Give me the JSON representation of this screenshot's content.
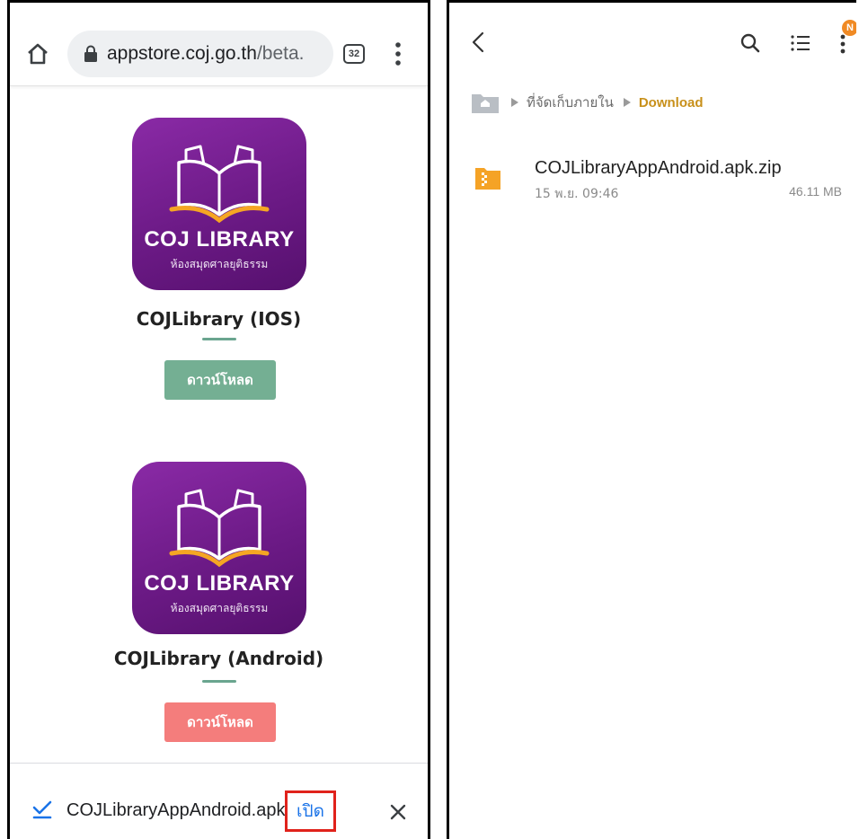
{
  "browser": {
    "url_host": "appstore.coj.go.th",
    "url_path": "/beta.",
    "tab_count": "32"
  },
  "apps": [
    {
      "icon_title": "COJ LIBRARY",
      "icon_subtitle": "ห้องสมุดศาลยุติธรรม",
      "name": "COJLibrary (IOS)",
      "download_label": "ดาวน์โหลด",
      "button_color": "#74af93"
    },
    {
      "icon_title": "COJ LIBRARY",
      "icon_subtitle": "ห้องสมุดศาลยุติธรรม",
      "name": "COJLibrary (Android)",
      "download_label": "ดาวน์โหลด",
      "button_color": "#f47d7c"
    }
  ],
  "download_bar": {
    "filename": "COJLibraryAppAndroid.apk",
    "open_label": "เปิด",
    "highlight_color": "#e0221b"
  },
  "file_manager": {
    "notification_badge": "N",
    "breadcrumb": {
      "storage": "ที่จัดเก็บภายใน",
      "current": "Download"
    },
    "files": [
      {
        "name": "COJLibraryAppAndroid.apk.zip",
        "date": "15 พ.ย. 09:46",
        "size": "46.11 MB",
        "icon": "zip-folder-icon"
      }
    ],
    "accent_color": "#f08a24"
  }
}
